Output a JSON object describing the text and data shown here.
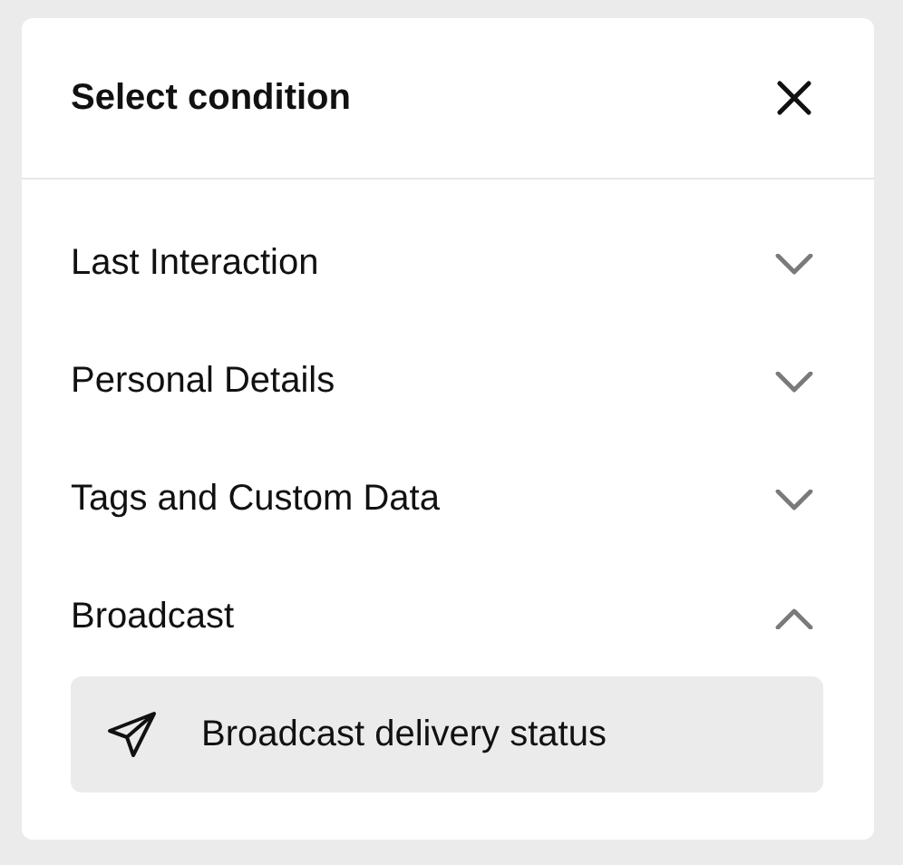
{
  "dialog": {
    "title": "Select condition"
  },
  "sections": [
    {
      "label": "Last Interaction",
      "expanded": false
    },
    {
      "label": "Personal Details",
      "expanded": false
    },
    {
      "label": "Tags and Custom Data",
      "expanded": false
    },
    {
      "label": "Broadcast",
      "expanded": true,
      "children": [
        {
          "label": "Broadcast delivery status"
        }
      ]
    }
  ]
}
